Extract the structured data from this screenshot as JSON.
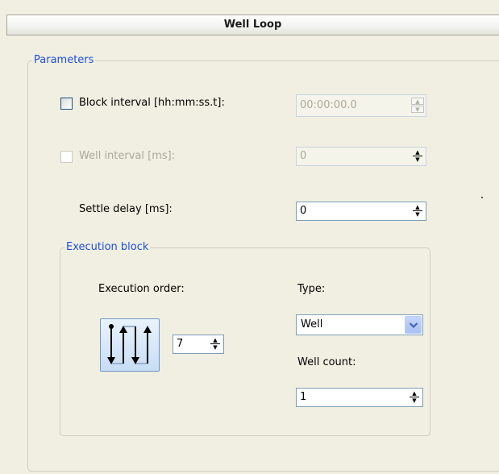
{
  "window": {
    "title": "Well Loop"
  },
  "parameters": {
    "group_label": "Parameters",
    "block_interval": {
      "label": "Block interval [hh:mm:ss.t]:",
      "checked": false,
      "enabled": true,
      "value": "00:00:00.0",
      "value_enabled": false
    },
    "well_interval": {
      "label": "Well interval [ms]:",
      "checked": false,
      "enabled": false,
      "value": "0",
      "value_enabled": false
    },
    "settle_delay": {
      "label": "Settle delay [ms]:",
      "value": "0"
    }
  },
  "execution_block": {
    "group_label": "Execution block",
    "execution_order": {
      "label": "Execution order:",
      "icon": "serpentine-order-icon",
      "value": "7"
    },
    "type": {
      "label": "Type:",
      "selected": "Well"
    },
    "well_count": {
      "label": "Well count:",
      "value": "1"
    }
  },
  "colors": {
    "background": "#f1efe2",
    "group_label": "#1c4fd8",
    "field_border": "#7f9db9",
    "disabled_text": "#aca899",
    "combo_button": "#b6cbf5"
  }
}
